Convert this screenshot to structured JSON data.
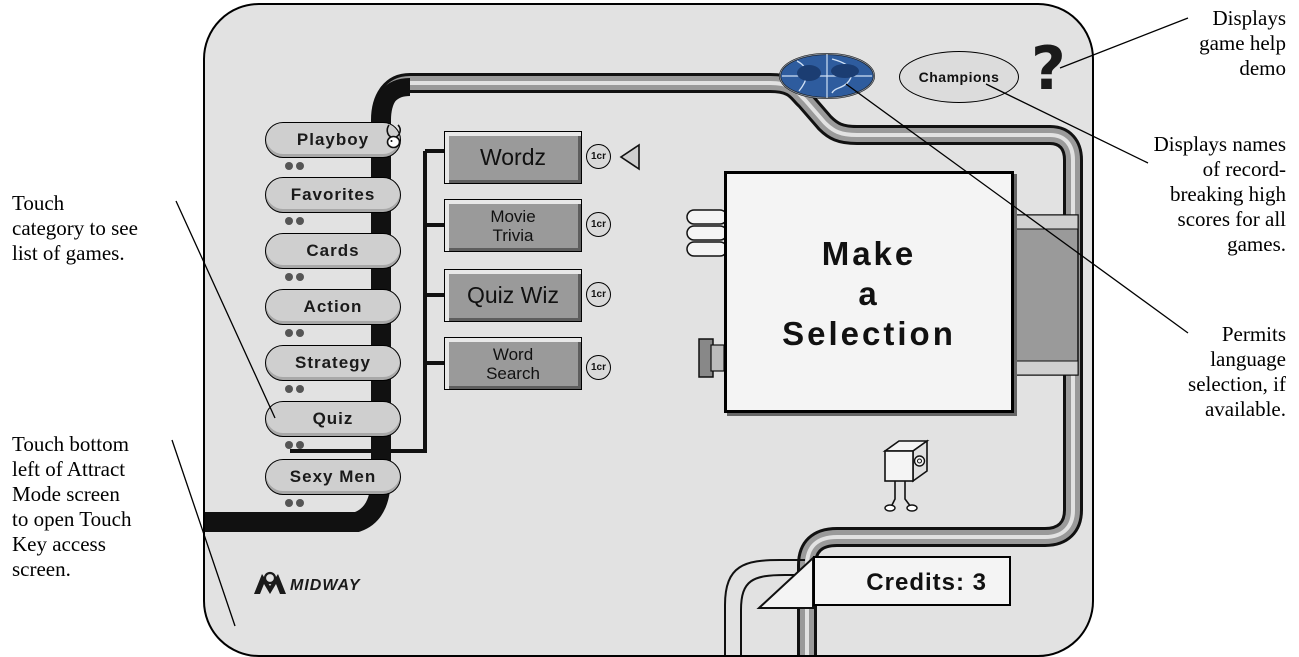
{
  "annotations": {
    "left_touch_category": [
      "Touch",
      "category to see",
      "list of games."
    ],
    "left_touch_bottom": [
      "Touch bottom",
      "left of Attract",
      "Mode screen",
      "to open Touch",
      "Key access",
      "screen."
    ],
    "right_help": [
      "Displays",
      "game help",
      "demo"
    ],
    "right_champions": [
      "Displays names",
      "of record-",
      "breaking high",
      "scores for all",
      "games."
    ],
    "right_language": [
      "Permits",
      "language",
      "selection, if",
      "available."
    ]
  },
  "categories": [
    {
      "label": "Playboy"
    },
    {
      "label": "Favorites"
    },
    {
      "label": "Cards"
    },
    {
      "label": "Action"
    },
    {
      "label": "Strategy"
    },
    {
      "label": "Quiz"
    },
    {
      "label": "Sexy Men"
    }
  ],
  "games": [
    {
      "lines": [
        "Wordz"
      ],
      "cost": "1cr",
      "selected": true
    },
    {
      "lines": [
        "Movie",
        "Trivia"
      ],
      "cost": "1cr"
    },
    {
      "lines": [
        "Quiz Wiz"
      ],
      "cost": "1cr"
    },
    {
      "lines": [
        "Word",
        "Search"
      ],
      "cost": "1cr"
    }
  ],
  "panel": {
    "lines": [
      "Make",
      "a",
      "Selection"
    ]
  },
  "champions_label": "Champions",
  "help_label": "?",
  "credits_label": "Credits: 3",
  "brand": "MIDWAY",
  "icons": {
    "language": "globe-icon",
    "help": "question-mark-icon",
    "bunny": "bunny-icon",
    "mascot": "cube-mascot-icon",
    "selector": "triangle-pointer-icon",
    "logo": "midway-logo-icon"
  }
}
